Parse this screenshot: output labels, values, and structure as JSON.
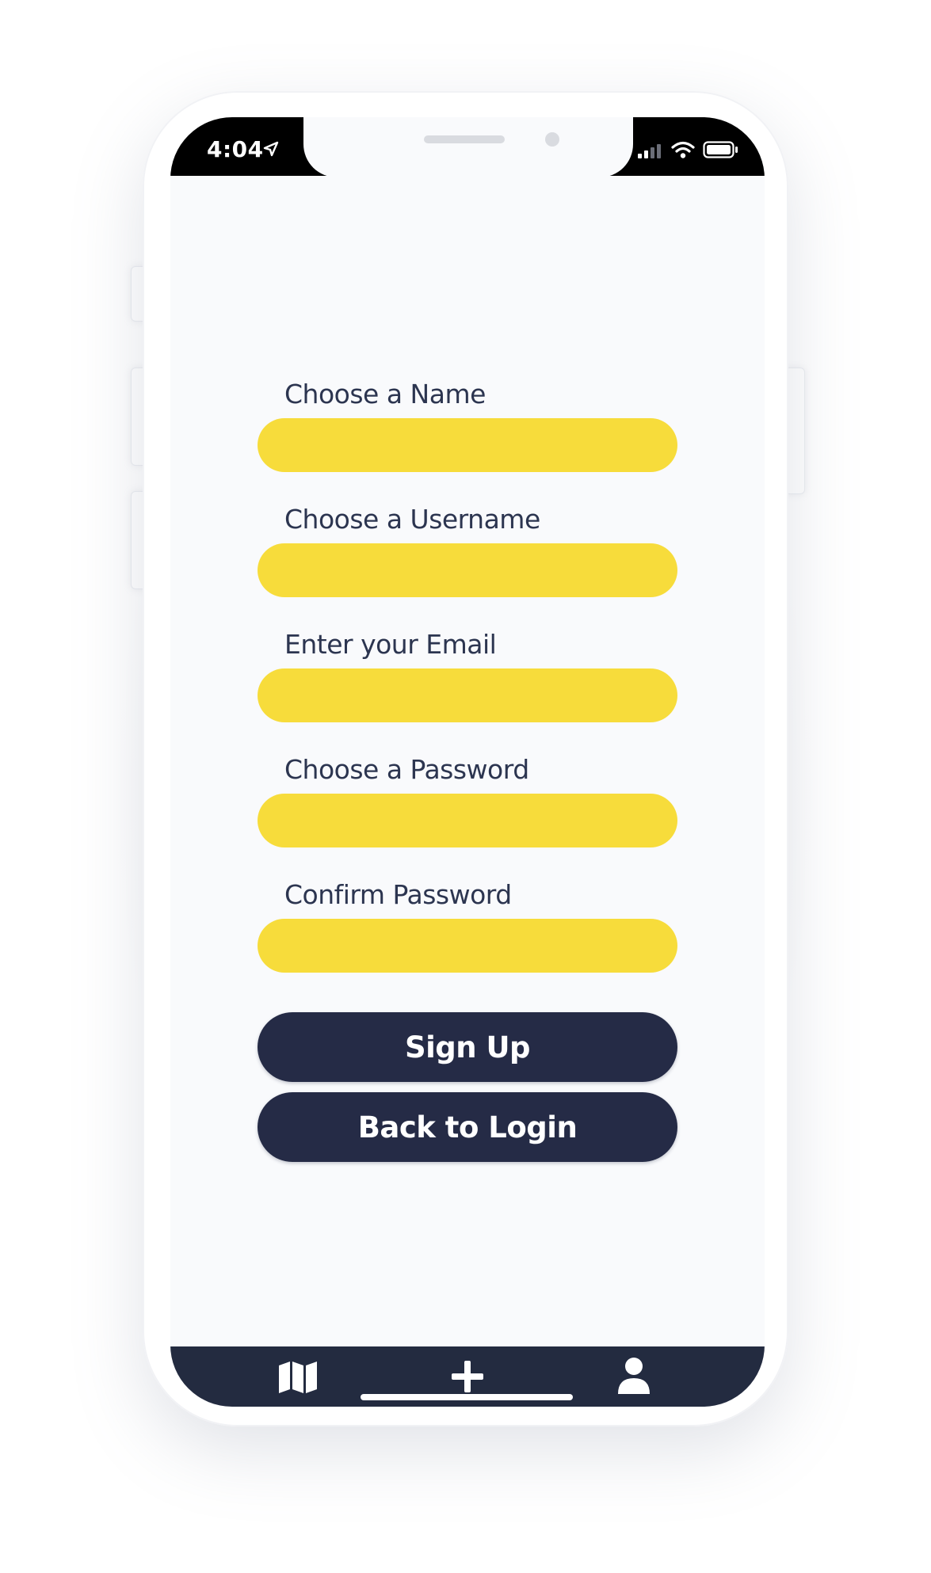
{
  "status_bar": {
    "time": "4:04",
    "location_icon": "location-arrow-icon",
    "signal_icon": "cellular-signal-icon",
    "wifi_icon": "wifi-icon",
    "battery_icon": "battery-icon"
  },
  "form": {
    "fields": [
      {
        "label": "Choose a Name",
        "value": "",
        "type": "text"
      },
      {
        "label": "Choose a Username",
        "value": "",
        "type": "text"
      },
      {
        "label": "Enter your Email",
        "value": "",
        "type": "email"
      },
      {
        "label": "Choose a Password",
        "value": "",
        "type": "password"
      },
      {
        "label": "Confirm Password",
        "value": "",
        "type": "password"
      }
    ],
    "sign_up_label": "Sign Up",
    "back_to_login_label": "Back to Login"
  },
  "tab_bar": {
    "items": [
      {
        "icon": "map-icon"
      },
      {
        "icon": "plus-icon"
      },
      {
        "icon": "user-icon"
      }
    ]
  },
  "colors": {
    "input_fill": "#f7dc3b",
    "button_fill": "#252b46",
    "label_text": "#2c3550",
    "tab_bar": "#232b40",
    "screen_bg": "#f9fafc"
  }
}
